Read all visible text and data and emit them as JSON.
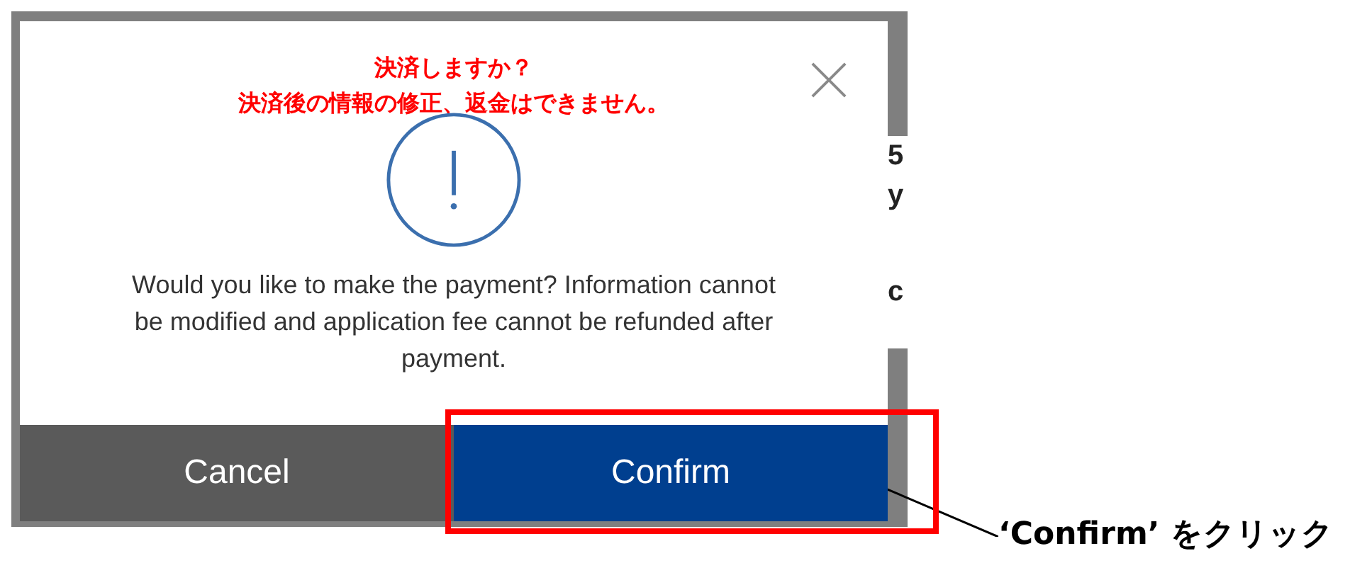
{
  "background": {
    "fragments": [
      "5",
      "y",
      "c"
    ]
  },
  "dialog": {
    "notice_lines": [
      "決済しますか？",
      "決済後の情報の修正、返金はできません。"
    ],
    "message": "Would you like to make the payment? Information cannot be modified and application fee cannot be refunded after payment.",
    "buttons": [
      {
        "label": "Cancel",
        "kind": "secondary"
      },
      {
        "label": "Confirm",
        "kind": "primary"
      }
    ]
  },
  "annotation": {
    "text": "‘**Confirm**’ をクリック"
  }
}
